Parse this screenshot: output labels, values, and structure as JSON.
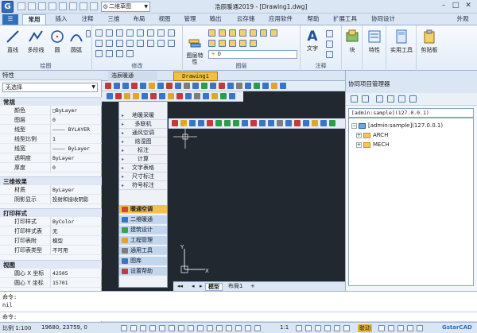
{
  "title_bar": {
    "workspace": "二维草图",
    "title": "浩辰暖通2019 - [Drawing1.dwg]",
    "min": "–",
    "max": "□",
    "close": "✕",
    "extra": "外观"
  },
  "ribbon_tabs": [
    "常用",
    "插入",
    "注释",
    "三维",
    "布局",
    "视图",
    "管理",
    "输出",
    "云存储",
    "应用软件",
    "帮助",
    "扩展工具",
    "协同设计"
  ],
  "ribbon": {
    "groups": {
      "draw": {
        "label": "绘图",
        "buttons": [
          "直线",
          "多段线",
          "圆",
          "圆弧"
        ]
      },
      "modify": {
        "label": "修改"
      },
      "layer": {
        "label": "图层",
        "buttons": [
          "图层特性"
        ]
      },
      "annotate": {
        "label": "注释",
        "buttons": [
          "文字"
        ]
      },
      "block": {
        "buttons": [
          "块"
        ]
      },
      "props": {
        "buttons": [
          "特性"
        ]
      },
      "utils": {
        "buttons": [
          "实用工具"
        ]
      },
      "clipboard": {
        "buttons": [
          "剪贴板"
        ]
      }
    }
  },
  "properties": {
    "header": "特性",
    "selection": "无选择",
    "sections": [
      {
        "title": "常规",
        "rows": [
          [
            "颜色",
            "□ByLayer"
          ],
          [
            "图层",
            "0"
          ],
          [
            "线型",
            "———— BYLAYER"
          ],
          [
            "线型比例",
            "1"
          ],
          [
            "线宽",
            "———— ByLayer"
          ],
          [
            "透明度",
            "ByLayer"
          ],
          [
            "厚度",
            "0"
          ]
        ]
      },
      {
        "title": "三维效果",
        "rows": [
          [
            "材质",
            "ByLayer"
          ],
          [
            "阴影显示",
            "投射和接收阴影"
          ]
        ]
      },
      {
        "title": "打印样式",
        "rows": [
          [
            "打印样式",
            "ByColor"
          ],
          [
            "打印样式表",
            "无"
          ],
          [
            "打印表附",
            "模型"
          ],
          [
            "打印表类型",
            "不可用"
          ]
        ]
      },
      {
        "title": "视图",
        "rows": [
          [
            "圆心 X 坐标",
            "42505"
          ],
          [
            "圆心 Y 坐标",
            "15701"
          ]
        ]
      }
    ]
  },
  "tangent_panel": {
    "title": "浩辰暖通",
    "items": [
      "地暖采暖",
      "多联机",
      "通风空调",
      "焓湿图",
      "标注",
      "计算",
      "文字表格",
      "尺寸标注",
      "符号标注"
    ],
    "modules": [
      "暖通空调",
      "二维暖通",
      "建筑设计",
      "工程管理",
      "通用工具",
      "图库",
      "设置帮助"
    ]
  },
  "doc_tab": "Drawing1",
  "layout_tabs": [
    "模型",
    "布局1",
    "+"
  ],
  "collab": {
    "title": "协同项目管理器",
    "path": "[admin:sample](127.0.0.1)",
    "root": "[admin:sample](127.0.0.1)",
    "children": [
      "ARCH",
      "MECH"
    ]
  },
  "command": {
    "lines": [
      "命令:",
      "nil",
      "命令:"
    ]
  },
  "status": {
    "scale": "比例 1:100",
    "coords": "19680, 23759, 0",
    "linkage": "联动",
    "zoom": "1:1",
    "brand": "GstarCAD"
  },
  "colors": {
    "accent": "#2f6fbf",
    "canvas": "#212830",
    "highlight": "#f6c050",
    "doc_tab": "#f0c040"
  }
}
